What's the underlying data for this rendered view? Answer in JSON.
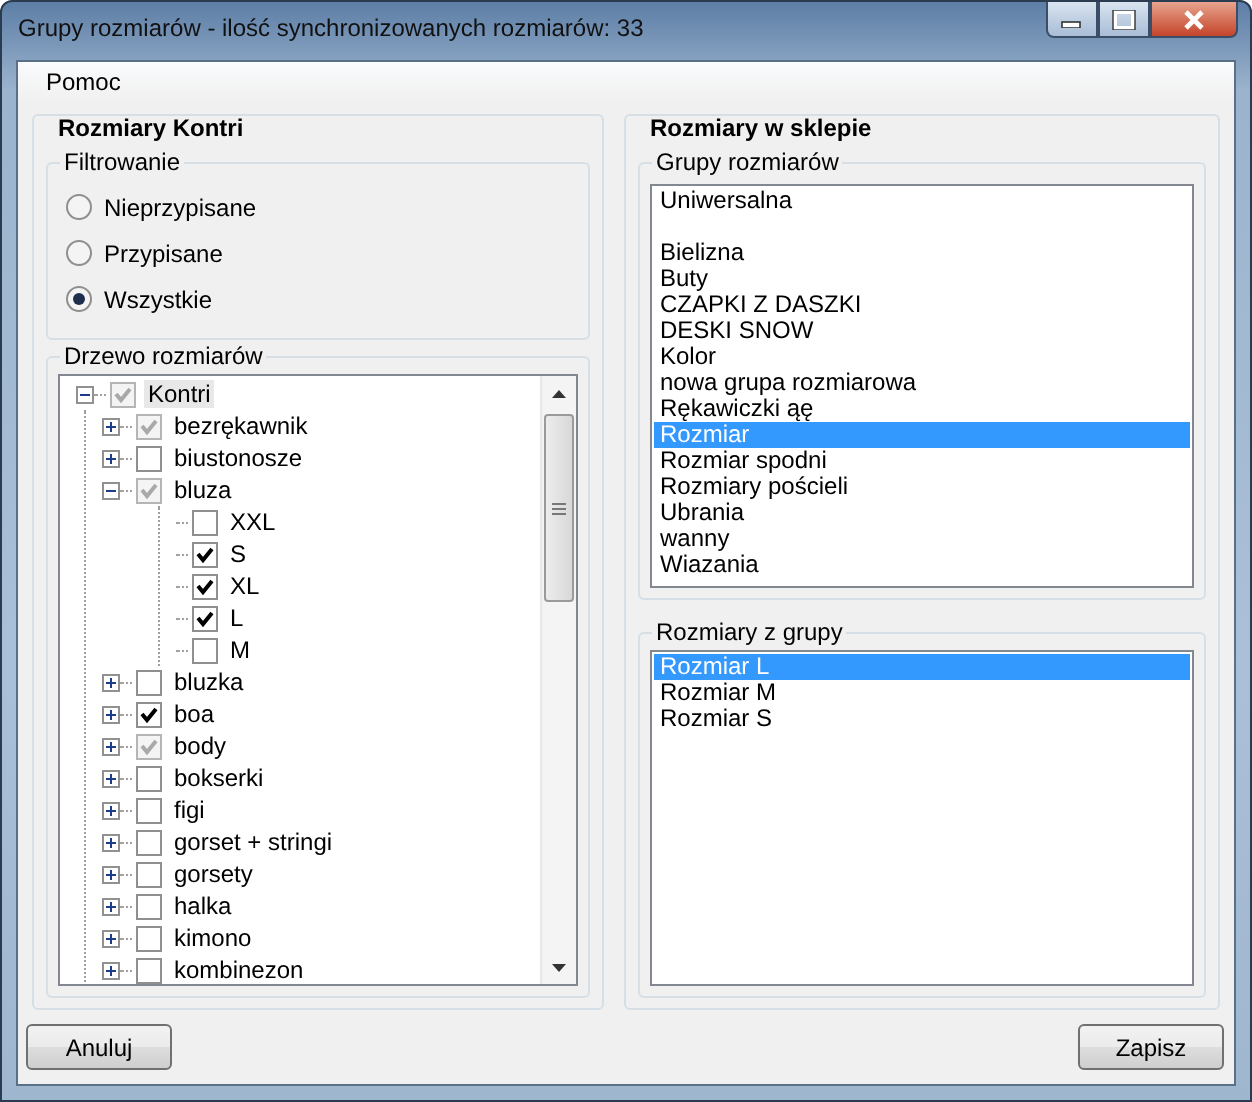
{
  "window": {
    "title": "Grupy rozmiarów - ilość synchronizowanych rozmiarów: 33"
  },
  "menu": [
    {
      "label": "Pomoc"
    }
  ],
  "left": {
    "title": "Rozmiary Kontri",
    "filter": {
      "title": "Filtrowanie",
      "options": [
        {
          "label": "Nieprzypisane",
          "selected": false
        },
        {
          "label": "Przypisane",
          "selected": false
        },
        {
          "label": "Wszystkie",
          "selected": true
        }
      ]
    },
    "tree": {
      "title": "Drzewo rozmiarów",
      "nodes": [
        {
          "label": "Kontri",
          "checked": true,
          "grayed": true,
          "expanded": true,
          "selected": true,
          "children": [
            {
              "label": "bezrękawnik",
              "checked": true,
              "grayed": true,
              "expanded": false,
              "selected": false
            },
            {
              "label": "biustonosze",
              "checked": false,
              "grayed": false,
              "expanded": false,
              "selected": false
            },
            {
              "label": "bluza",
              "checked": true,
              "grayed": true,
              "expanded": true,
              "selected": false,
              "children": [
                {
                  "label": "XXL",
                  "checked": false,
                  "grayed": false,
                  "selected": false
                },
                {
                  "label": "S",
                  "checked": true,
                  "grayed": false,
                  "selected": false
                },
                {
                  "label": "XL",
                  "checked": true,
                  "grayed": false,
                  "selected": false
                },
                {
                  "label": "L",
                  "checked": true,
                  "grayed": false,
                  "selected": false
                },
                {
                  "label": "M",
                  "checked": false,
                  "grayed": false,
                  "selected": false
                }
              ]
            },
            {
              "label": "bluzka",
              "checked": false,
              "grayed": false,
              "expanded": false,
              "selected": false
            },
            {
              "label": "boa",
              "checked": true,
              "grayed": false,
              "expanded": false,
              "selected": false
            },
            {
              "label": "body",
              "checked": true,
              "grayed": true,
              "expanded": false,
              "selected": false
            },
            {
              "label": "bokserki",
              "checked": false,
              "grayed": false,
              "expanded": false,
              "selected": false
            },
            {
              "label": "figi",
              "checked": false,
              "grayed": false,
              "expanded": false,
              "selected": false
            },
            {
              "label": "gorset + stringi",
              "checked": false,
              "grayed": false,
              "expanded": false,
              "selected": false
            },
            {
              "label": "gorsety",
              "checked": false,
              "grayed": false,
              "expanded": false,
              "selected": false
            },
            {
              "label": "halka",
              "checked": false,
              "grayed": false,
              "expanded": false,
              "selected": false
            },
            {
              "label": "kimono",
              "checked": false,
              "grayed": false,
              "expanded": false,
              "selected": false
            },
            {
              "label": "kombinezon",
              "checked": false,
              "grayed": false,
              "expanded": false,
              "selected": false
            }
          ]
        }
      ]
    }
  },
  "right": {
    "title": "Rozmiary w sklepie",
    "groups": {
      "title": "Grupy rozmiarów",
      "items": [
        {
          "label": "Uniwersalna",
          "selected": false,
          "gap_after": true
        },
        {
          "label": "Bielizna",
          "selected": false
        },
        {
          "label": "Buty",
          "selected": false
        },
        {
          "label": "CZAPKI Z DASZKI",
          "selected": false
        },
        {
          "label": "DESKI SNOW",
          "selected": false
        },
        {
          "label": "Kolor",
          "selected": false
        },
        {
          "label": "nowa grupa rozmiarowa",
          "selected": false
        },
        {
          "label": "Rękawiczki ąę",
          "selected": false
        },
        {
          "label": "Rozmiar",
          "selected": true
        },
        {
          "label": "Rozmiar spodni",
          "selected": false
        },
        {
          "label": "Rozmiary pościeli",
          "selected": false
        },
        {
          "label": "Ubrania",
          "selected": false
        },
        {
          "label": "wanny",
          "selected": false
        },
        {
          "label": "Wiazania",
          "selected": false
        }
      ]
    },
    "sizes": {
      "title": "Rozmiary z grupy",
      "items": [
        {
          "label": "Rozmiar L",
          "selected": true
        },
        {
          "label": "Rozmiar M",
          "selected": false
        },
        {
          "label": "Rozmiar S",
          "selected": false
        }
      ]
    }
  },
  "buttons": {
    "cancel": "Anuluj",
    "save": "Zapisz"
  }
}
